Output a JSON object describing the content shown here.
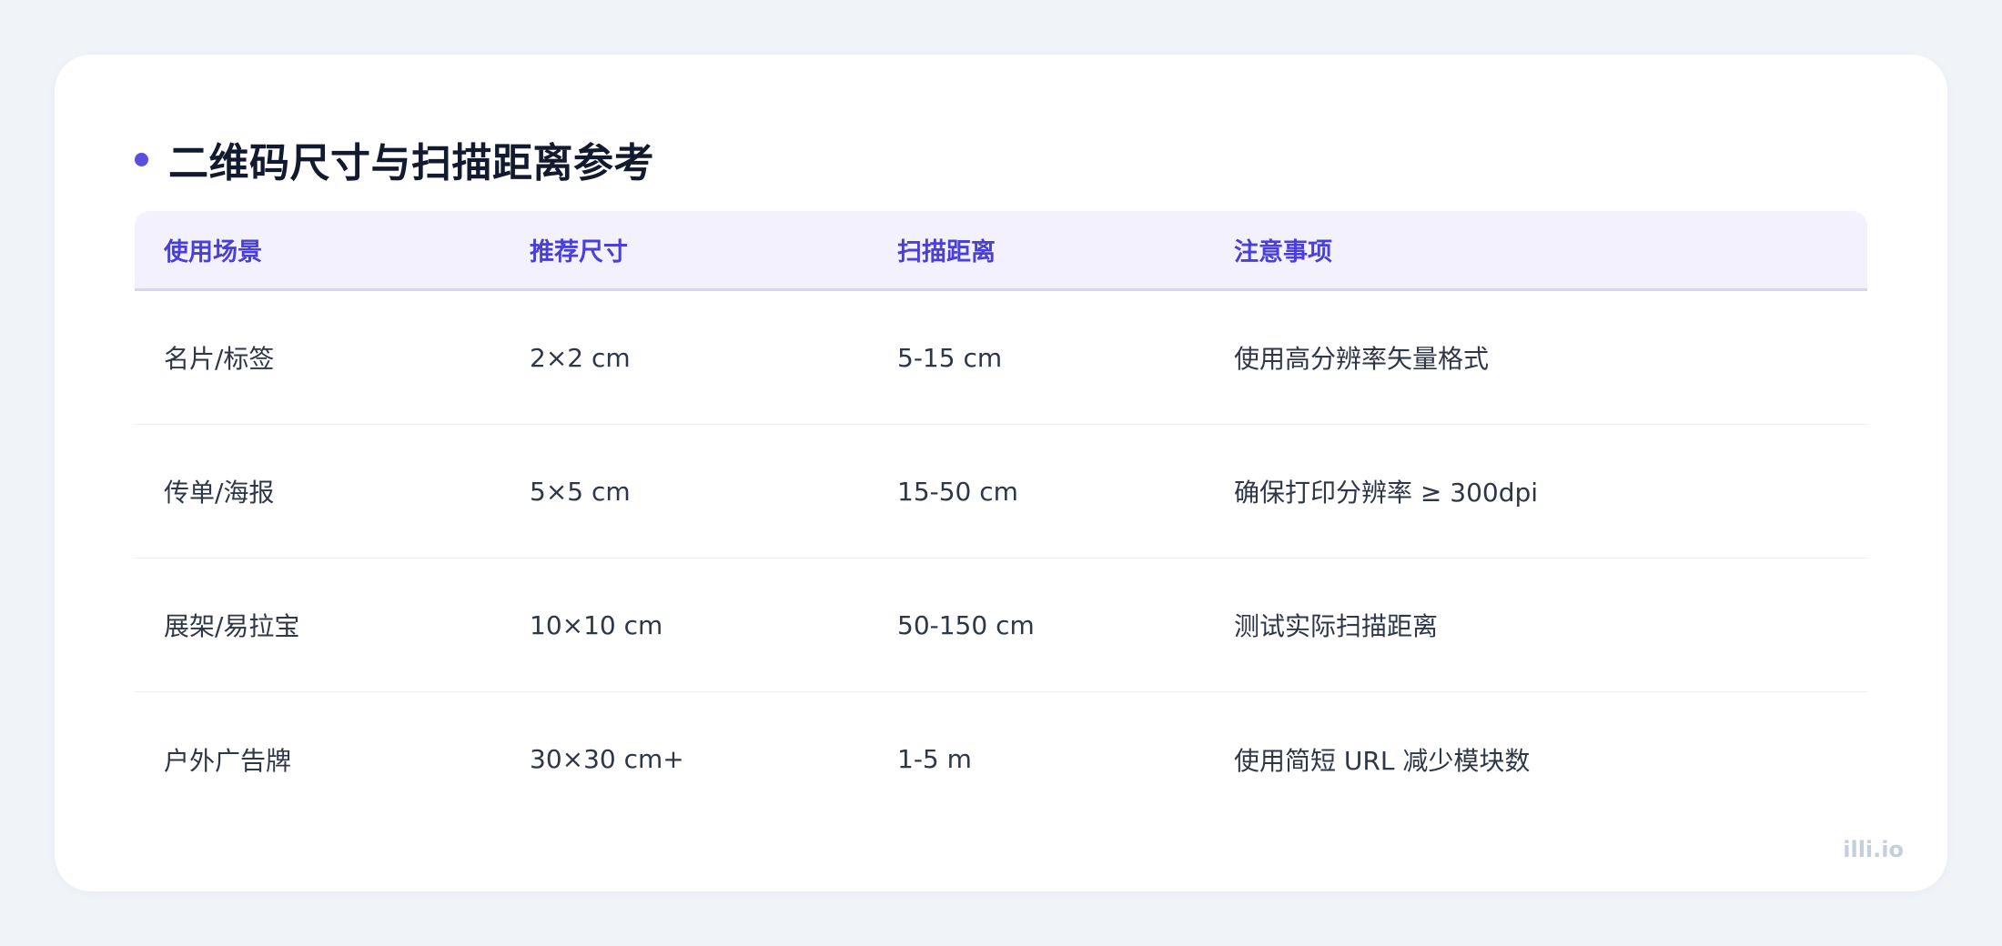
{
  "title": "二维码尺寸与扫描距离参考",
  "table": {
    "headers": [
      "使用场景",
      "推荐尺寸",
      "扫描距离",
      "注意事项"
    ],
    "rows": [
      [
        "名片/标签",
        "2×2 cm",
        "5-15 cm",
        "使用高分辨率矢量格式"
      ],
      [
        "传单/海报",
        "5×5 cm",
        "15-50 cm",
        "确保打印分辨率 ≥ 300dpi"
      ],
      [
        "展架/易拉宝",
        "10×10 cm",
        "50-150 cm",
        "测试实际扫描距离"
      ],
      [
        "户外广告牌",
        "30×30 cm+",
        "1-5 m",
        "使用简短 URL 减少模块数"
      ]
    ]
  },
  "watermark": "illi.io",
  "colors": {
    "accent": "#5b4ee0",
    "header_text": "#4a3fd6",
    "header_bg": "#f3f1fd",
    "page_bg": "#f0f3f8",
    "card_bg": "#ffffff"
  }
}
